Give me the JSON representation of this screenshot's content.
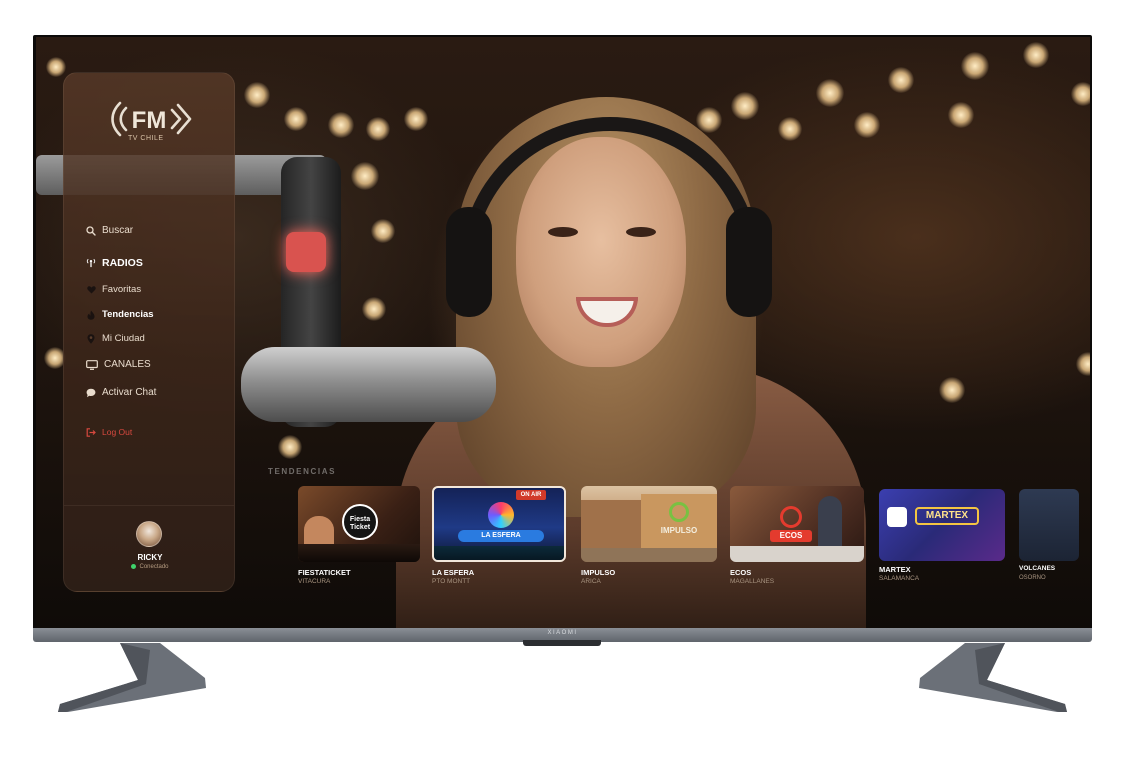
{
  "logo": {
    "main": "FM",
    "sub": "TV CHILE"
  },
  "sidebar": {
    "items": [
      {
        "key": "search",
        "label": "Buscar"
      },
      {
        "key": "radios",
        "label": "RADIOS"
      },
      {
        "key": "favorites",
        "label": "Favoritas"
      },
      {
        "key": "trends",
        "label": "Tendencias"
      },
      {
        "key": "city",
        "label": "Mi Ciudad"
      },
      {
        "key": "channels",
        "label": "CANALES"
      },
      {
        "key": "chat",
        "label": "Activar Chat"
      },
      {
        "key": "logout",
        "label": "Log Out"
      }
    ],
    "user": {
      "name": "RICKY",
      "status": "Conectado"
    }
  },
  "trends": {
    "title": "TENDENCIAS",
    "cards": [
      {
        "name": "FIESTATICKET",
        "city": "VITACURA",
        "badge": "Fiesta Ticket",
        "bg": "#4a2a1a"
      },
      {
        "name": "LA ESFERA",
        "city": "PTO MONTT",
        "badge": "LA ESFERA",
        "tag": "ON AIR",
        "bg": "#1d2a5a"
      },
      {
        "name": "IMPULSO",
        "city": "ARICA",
        "badge": "IMPULSO",
        "bg": "#b98a5c"
      },
      {
        "name": "ECOS",
        "city": "MAGALLANES",
        "badge": "ECOS",
        "bg": "#5a3328"
      },
      {
        "name": "MARTEX",
        "city": "SALAMANCA",
        "badge": "MARTEX",
        "bg": "#2b2a7a"
      },
      {
        "name": "VOLCANES",
        "city": "OSORNO",
        "bg": "#2a3346"
      }
    ]
  },
  "tv": {
    "brand": "XIAOMI"
  },
  "colors": {
    "accent_logout": "#d8493f",
    "online": "#3fd26b"
  }
}
